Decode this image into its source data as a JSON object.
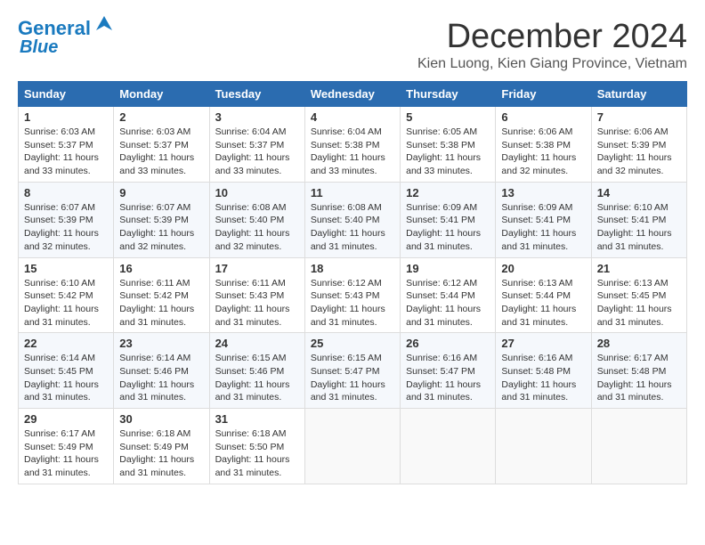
{
  "header": {
    "logo_line1": "General",
    "logo_line2": "Blue",
    "month": "December 2024",
    "location": "Kien Luong, Kien Giang Province, Vietnam"
  },
  "weekdays": [
    "Sunday",
    "Monday",
    "Tuesday",
    "Wednesday",
    "Thursday",
    "Friday",
    "Saturday"
  ],
  "weeks": [
    [
      {
        "day": "1",
        "sunrise": "6:03 AM",
        "sunset": "5:37 PM",
        "daylight": "11 hours and 33 minutes."
      },
      {
        "day": "2",
        "sunrise": "6:03 AM",
        "sunset": "5:37 PM",
        "daylight": "11 hours and 33 minutes."
      },
      {
        "day": "3",
        "sunrise": "6:04 AM",
        "sunset": "5:37 PM",
        "daylight": "11 hours and 33 minutes."
      },
      {
        "day": "4",
        "sunrise": "6:04 AM",
        "sunset": "5:38 PM",
        "daylight": "11 hours and 33 minutes."
      },
      {
        "day": "5",
        "sunrise": "6:05 AM",
        "sunset": "5:38 PM",
        "daylight": "11 hours and 33 minutes."
      },
      {
        "day": "6",
        "sunrise": "6:06 AM",
        "sunset": "5:38 PM",
        "daylight": "11 hours and 32 minutes."
      },
      {
        "day": "7",
        "sunrise": "6:06 AM",
        "sunset": "5:39 PM",
        "daylight": "11 hours and 32 minutes."
      }
    ],
    [
      {
        "day": "8",
        "sunrise": "6:07 AM",
        "sunset": "5:39 PM",
        "daylight": "11 hours and 32 minutes."
      },
      {
        "day": "9",
        "sunrise": "6:07 AM",
        "sunset": "5:39 PM",
        "daylight": "11 hours and 32 minutes."
      },
      {
        "day": "10",
        "sunrise": "6:08 AM",
        "sunset": "5:40 PM",
        "daylight": "11 hours and 32 minutes."
      },
      {
        "day": "11",
        "sunrise": "6:08 AM",
        "sunset": "5:40 PM",
        "daylight": "11 hours and 31 minutes."
      },
      {
        "day": "12",
        "sunrise": "6:09 AM",
        "sunset": "5:41 PM",
        "daylight": "11 hours and 31 minutes."
      },
      {
        "day": "13",
        "sunrise": "6:09 AM",
        "sunset": "5:41 PM",
        "daylight": "11 hours and 31 minutes."
      },
      {
        "day": "14",
        "sunrise": "6:10 AM",
        "sunset": "5:41 PM",
        "daylight": "11 hours and 31 minutes."
      }
    ],
    [
      {
        "day": "15",
        "sunrise": "6:10 AM",
        "sunset": "5:42 PM",
        "daylight": "11 hours and 31 minutes."
      },
      {
        "day": "16",
        "sunrise": "6:11 AM",
        "sunset": "5:42 PM",
        "daylight": "11 hours and 31 minutes."
      },
      {
        "day": "17",
        "sunrise": "6:11 AM",
        "sunset": "5:43 PM",
        "daylight": "11 hours and 31 minutes."
      },
      {
        "day": "18",
        "sunrise": "6:12 AM",
        "sunset": "5:43 PM",
        "daylight": "11 hours and 31 minutes."
      },
      {
        "day": "19",
        "sunrise": "6:12 AM",
        "sunset": "5:44 PM",
        "daylight": "11 hours and 31 minutes."
      },
      {
        "day": "20",
        "sunrise": "6:13 AM",
        "sunset": "5:44 PM",
        "daylight": "11 hours and 31 minutes."
      },
      {
        "day": "21",
        "sunrise": "6:13 AM",
        "sunset": "5:45 PM",
        "daylight": "11 hours and 31 minutes."
      }
    ],
    [
      {
        "day": "22",
        "sunrise": "6:14 AM",
        "sunset": "5:45 PM",
        "daylight": "11 hours and 31 minutes."
      },
      {
        "day": "23",
        "sunrise": "6:14 AM",
        "sunset": "5:46 PM",
        "daylight": "11 hours and 31 minutes."
      },
      {
        "day": "24",
        "sunrise": "6:15 AM",
        "sunset": "5:46 PM",
        "daylight": "11 hours and 31 minutes."
      },
      {
        "day": "25",
        "sunrise": "6:15 AM",
        "sunset": "5:47 PM",
        "daylight": "11 hours and 31 minutes."
      },
      {
        "day": "26",
        "sunrise": "6:16 AM",
        "sunset": "5:47 PM",
        "daylight": "11 hours and 31 minutes."
      },
      {
        "day": "27",
        "sunrise": "6:16 AM",
        "sunset": "5:48 PM",
        "daylight": "11 hours and 31 minutes."
      },
      {
        "day": "28",
        "sunrise": "6:17 AM",
        "sunset": "5:48 PM",
        "daylight": "11 hours and 31 minutes."
      }
    ],
    [
      {
        "day": "29",
        "sunrise": "6:17 AM",
        "sunset": "5:49 PM",
        "daylight": "11 hours and 31 minutes."
      },
      {
        "day": "30",
        "sunrise": "6:18 AM",
        "sunset": "5:49 PM",
        "daylight": "11 hours and 31 minutes."
      },
      {
        "day": "31",
        "sunrise": "6:18 AM",
        "sunset": "5:50 PM",
        "daylight": "11 hours and 31 minutes."
      },
      null,
      null,
      null,
      null
    ]
  ]
}
